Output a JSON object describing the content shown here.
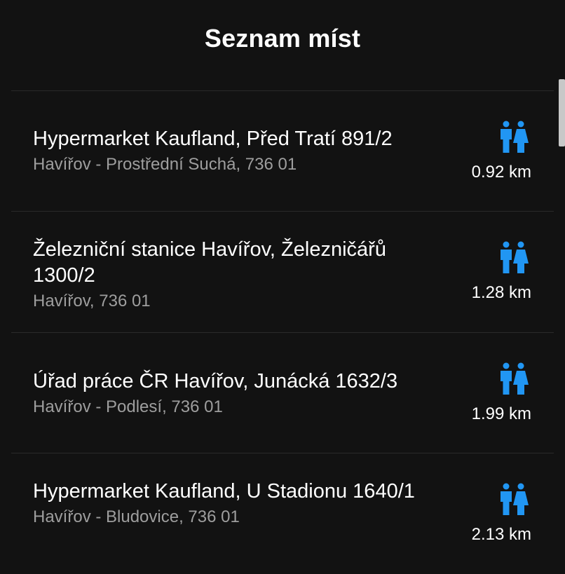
{
  "header": {
    "title": "Seznam míst"
  },
  "colors": {
    "background": "#121212",
    "accent_icon": "#2196f3",
    "subtitle": "#9e9e9e",
    "divider": "#2a2a2a"
  },
  "places": [
    {
      "title": "Hypermarket Kaufland, Před Tratí 891/2",
      "subtitle": "Havířov - Prostřední Suchá, 736 01",
      "distance": "0.92 km",
      "icon": "toilet-icon"
    },
    {
      "title": "Železniční stanice Havířov, Železničářů 1300/2",
      "subtitle": "Havířov, 736 01",
      "distance": "1.28 km",
      "icon": "toilet-icon"
    },
    {
      "title": "Úřad práce ČR Havířov, Junácká 1632/3",
      "subtitle": "Havířov - Podlesí, 736 01",
      "distance": "1.99 km",
      "icon": "toilet-icon"
    },
    {
      "title": "Hypermarket Kaufland, U Stadionu 1640/1",
      "subtitle": "Havířov - Bludovice, 736 01",
      "distance": "2.13 km",
      "icon": "toilet-icon"
    }
  ]
}
